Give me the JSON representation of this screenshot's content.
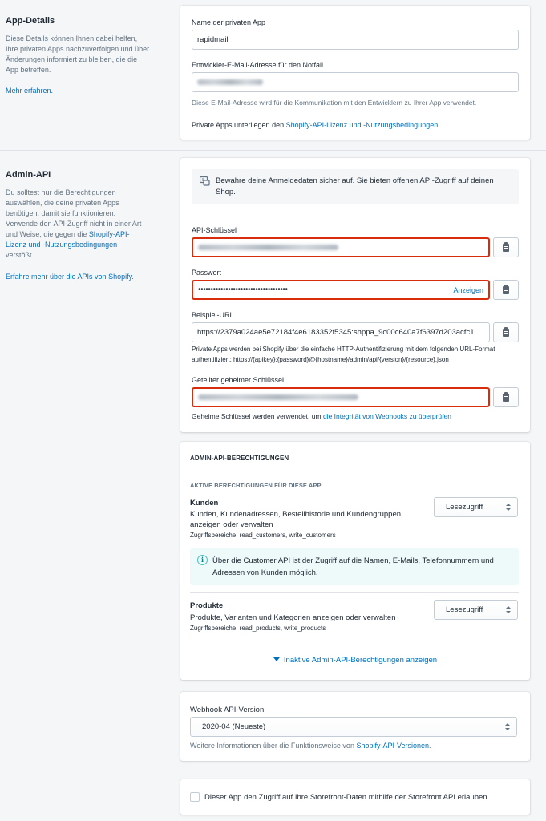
{
  "app_details": {
    "title": "App-Details",
    "description": "Diese Details können Ihnen dabei helfen, Ihre privaten Apps nachzuverfolgen und über Änderungen informiert zu bleiben, die die App betreffen.",
    "learn_more": "Mehr erfahren.",
    "app_name_label": "Name der privaten App",
    "app_name_value": "rapidmail",
    "email_label": "Entwickler-E-Mail-Adresse für den Notfall",
    "email_help": "Diese E-Mail-Adresse wird für die Kommunikation mit den Entwicklern zu Ihrer App verwendet.",
    "license_prefix": "Private Apps unterliegen den ",
    "license_link": "Shopify-API-Lizenz und -Nutzungsbedingungen",
    "license_suffix": "."
  },
  "admin_api": {
    "title": "Admin-API",
    "desc_prefix": "Du solltest nur die Berechtigungen auswählen, die deine privaten Apps benötigen, damit sie funktionieren. Verwende den API-Zugriff nicht in einer Art und Weise, die gegen die ",
    "desc_link": "Shopify-API-Lizenz und -Nutzungsbedingungen",
    "desc_suffix": " verstößt.",
    "learn_more": "Erfahre mehr über die APIs von Shopify.",
    "banner_text": "Bewahre deine Anmeldedaten sicher auf. Sie bieten offenen API-Zugriff auf deinen Shop.",
    "api_key_label": "API-Schlüssel",
    "password_label": "Passwort",
    "password_value": "••••••••••••••••••••••••••••••••••••",
    "show_label": "Anzeigen",
    "example_url_label": "Beispiel-URL",
    "example_url_value": "https://2379a024ae5e72184f4e6183352f5345:shppa_9c00c640a7f6397d203acfc1",
    "example_url_help": "Private Apps werden bei Shopify über die einfache HTTP-Authentifizierung mit dem folgenden URL-Format authentifiziert: https://{apikey}:{password}@{hostname}/admin/api/{version}/{resource}.json",
    "secret_label": "Geteilter geheimer Schlüssel",
    "secret_help_prefix": "Geheime Schlüssel werden verwendet, um ",
    "secret_help_link": "die Integrität von Webhooks zu überprüfen"
  },
  "permissions": {
    "heading": "ADMIN-API-BERECHTIGUNGEN",
    "subheading": "AKTIVE BERECHTIGUNGEN FÜR DIESE APP",
    "items": [
      {
        "title": "Kunden",
        "description": "Kunden, Kundenadressen, Bestellhistorie und Kundengruppen anzeigen oder verwalten",
        "scopes": "Zugriffsbereiche: read_customers, write_customers",
        "access": "Lesezugriff"
      },
      {
        "title": "Produkte",
        "description": "Produkte, Varianten und Kategorien anzeigen oder verwalten",
        "scopes": "Zugriffsbereiche: read_products, write_products",
        "access": "Lesezugriff"
      }
    ],
    "customer_info": "Über die Customer API ist der Zugriff auf die Namen, E-Mails, Telefonnummern und Adressen von Kunden möglich.",
    "show_inactive": "Inaktive Admin-API-Berechtigungen anzeigen"
  },
  "webhook": {
    "label": "Webhook API-Version",
    "version": "2020-04 (Neueste)",
    "help_prefix": "Weitere Informationen über die Funktionsweise von ",
    "help_link": "Shopify-API-Versionen",
    "help_suffix": "."
  },
  "storefront": {
    "checkbox_label": "Dieser App den Zugriff auf Ihre Storefront-Daten mithilfe der Storefront API erlauben"
  },
  "colors": {
    "link": "#006fbb",
    "highlight_border": "#d82c0d",
    "info_bg": "#eef9f9"
  }
}
